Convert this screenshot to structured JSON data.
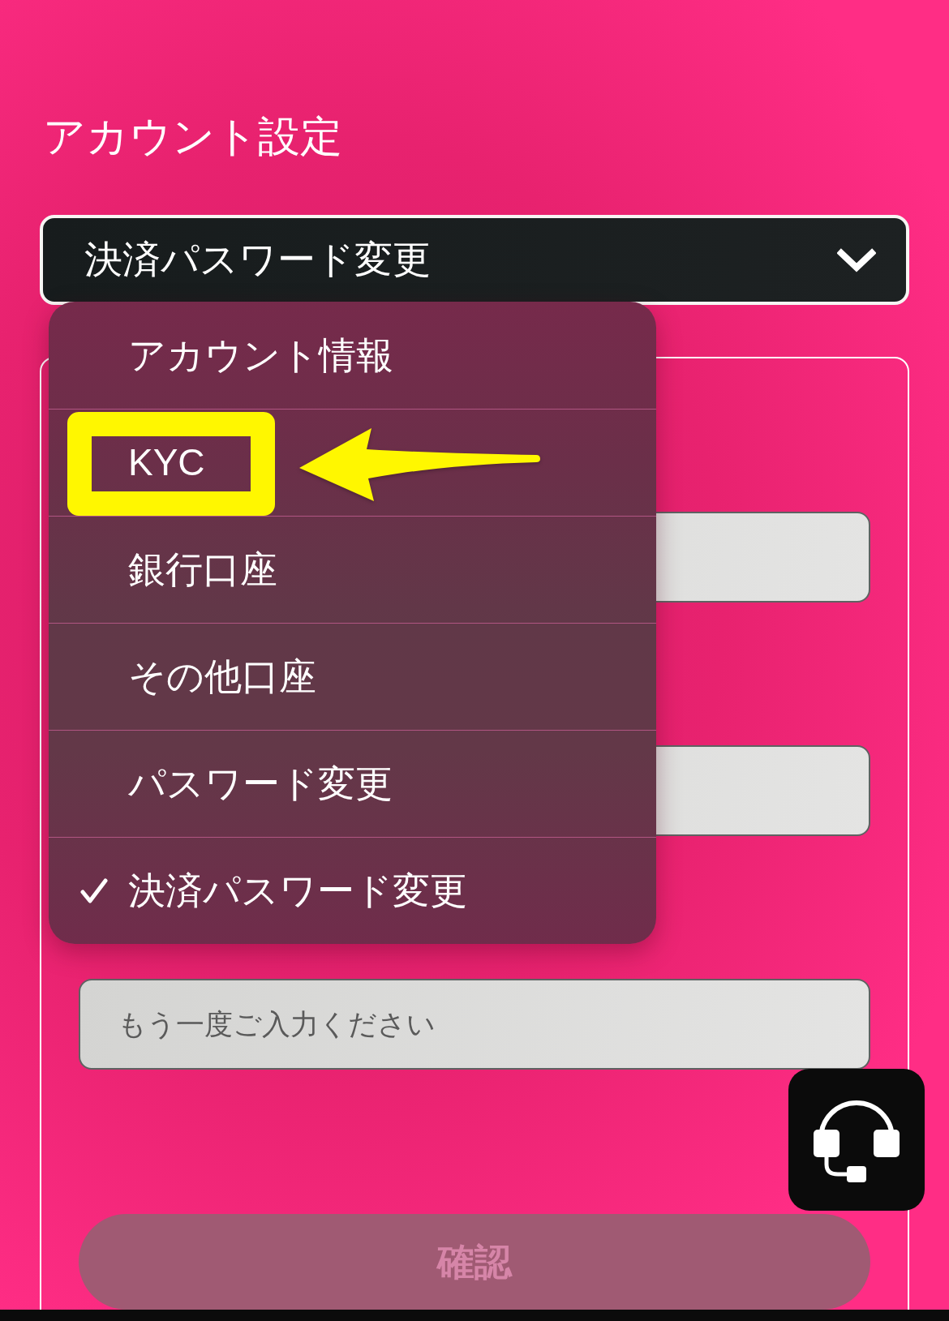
{
  "page": {
    "title": "アカウント設定"
  },
  "select": {
    "value": "決済パスワード変更",
    "expanded": true
  },
  "menu": {
    "items": [
      {
        "label": "アカウント情報",
        "selected": false,
        "highlighted": false
      },
      {
        "label": "KYC",
        "selected": false,
        "highlighted": true
      },
      {
        "label": "銀行口座",
        "selected": false,
        "highlighted": false
      },
      {
        "label": "その他口座",
        "selected": false,
        "highlighted": false
      },
      {
        "label": "パスワード変更",
        "selected": false,
        "highlighted": false
      },
      {
        "label": "決済パスワード変更",
        "selected": true,
        "highlighted": false
      }
    ]
  },
  "form": {
    "fields": [
      {
        "kind": "blank"
      },
      {
        "kind": "blank"
      },
      {
        "kind": "text",
        "placeholder": "もう一度ご入力ください"
      }
    ],
    "confirm_button": {
      "label": "確認",
      "disabled": true
    }
  }
}
